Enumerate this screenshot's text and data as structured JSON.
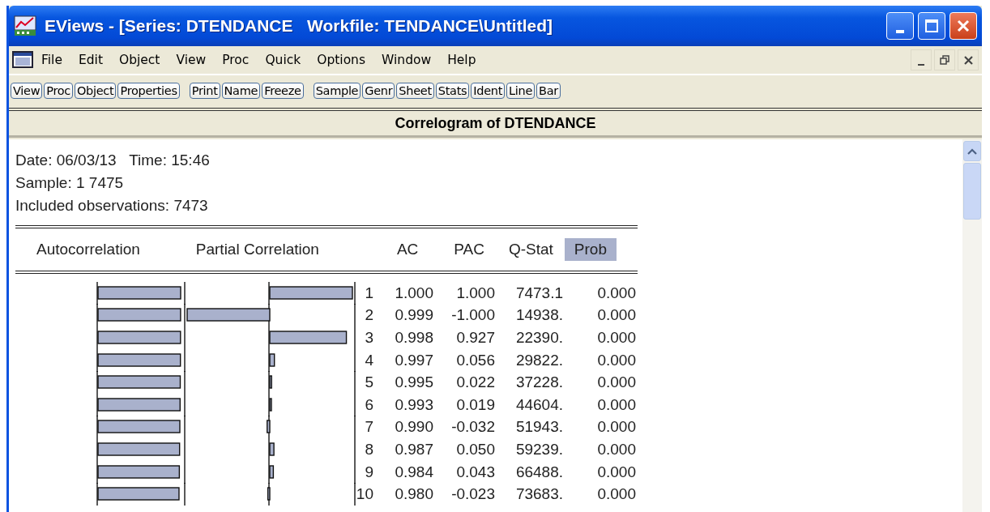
{
  "window": {
    "title": "EViews - [Series: DTENDANCE   Workfile: TENDANCE\\Untitled]"
  },
  "menu": [
    "File",
    "Edit",
    "Object",
    "View",
    "Proc",
    "Quick",
    "Options",
    "Window",
    "Help"
  ],
  "toolbar_groups": [
    [
      "View",
      "Proc",
      "Object",
      "Properties"
    ],
    [
      "Print",
      "Name",
      "Freeze"
    ],
    [
      "Sample",
      "Genr",
      "Sheet",
      "Stats",
      "Ident",
      "Line",
      "Bar"
    ]
  ],
  "view_title": "Correlogram of DTENDANCE",
  "info": [
    "Date: 06/03/13   Time: 15:46",
    "Sample: 1 7475",
    "Included observations: 7473"
  ],
  "table": {
    "columns": [
      {
        "label": "Autocorrelation",
        "selected": false
      },
      {
        "label": "Partial Correlation",
        "selected": false
      },
      {
        "label": "AC",
        "selected": false
      },
      {
        "label": "PAC",
        "selected": false
      },
      {
        "label": "Q-Stat",
        "selected": false
      },
      {
        "label": "Prob",
        "selected": true
      }
    ],
    "rows": [
      {
        "lag": "1",
        "ac": "1.000",
        "pac": "1.000",
        "q_stat": "7473.1",
        "prob": "0.000"
      },
      {
        "lag": "2",
        "ac": "0.999",
        "pac": "-1.000",
        "q_stat": "14938.",
        "prob": "0.000"
      },
      {
        "lag": "3",
        "ac": "0.998",
        "pac": "0.927",
        "q_stat": "22390.",
        "prob": "0.000"
      },
      {
        "lag": "4",
        "ac": "0.997",
        "pac": "0.056",
        "q_stat": "29822.",
        "prob": "0.000"
      },
      {
        "lag": "5",
        "ac": "0.995",
        "pac": "0.022",
        "q_stat": "37228.",
        "prob": "0.000"
      },
      {
        "lag": "6",
        "ac": "0.993",
        "pac": "0.019",
        "q_stat": "44604.",
        "prob": "0.000"
      },
      {
        "lag": "7",
        "ac": "0.990",
        "pac": "-0.032",
        "q_stat": "51943.",
        "prob": "0.000"
      },
      {
        "lag": "8",
        "ac": "0.987",
        "pac": "0.050",
        "q_stat": "59239.",
        "prob": "0.000"
      },
      {
        "lag": "9",
        "ac": "0.984",
        "pac": "0.043",
        "q_stat": "66488.",
        "prob": "0.000"
      },
      {
        "lag": "10",
        "ac": "0.980",
        "pac": "-0.023",
        "q_stat": "73683.",
        "prob": "0.000"
      }
    ]
  }
}
